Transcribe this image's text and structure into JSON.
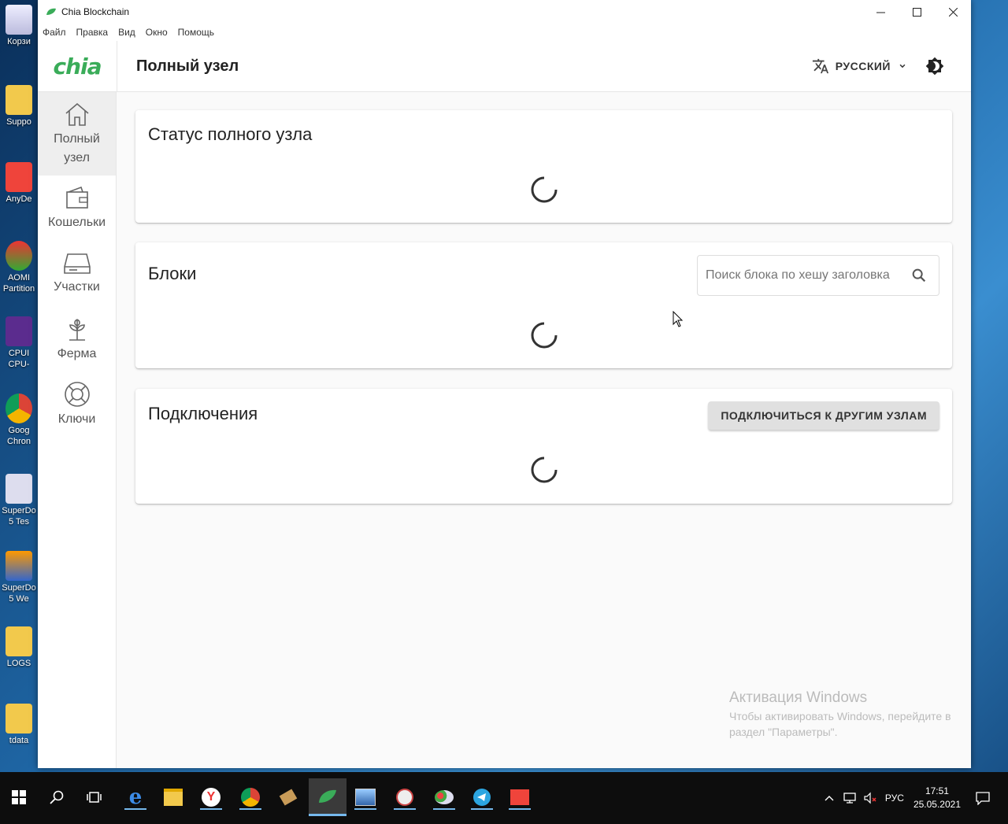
{
  "desktop": {
    "icons": [
      {
        "label": "Корзи",
        "icon": "recycle-bin-icon"
      },
      {
        "label": "Suppo",
        "icon": "folder-icon"
      },
      {
        "label": "AnyDe",
        "icon": "anydesk-icon"
      },
      {
        "label": "AOMI Partition",
        "icon": "partition-icon"
      },
      {
        "label": "CPUI CPU-",
        "icon": "cpuid-icon"
      },
      {
        "label": "Goog Chron",
        "icon": "chrome-icon"
      },
      {
        "label": "SuperDo 5 Tes",
        "icon": "superdoctor-icon"
      },
      {
        "label": "SuperDo 5 We",
        "icon": "superdoctor-web-icon"
      },
      {
        "label": "LOGS",
        "icon": "folder-icon"
      },
      {
        "label": "tdata",
        "icon": "folder-icon"
      }
    ]
  },
  "window": {
    "title": "Chia Blockchain",
    "menu": [
      "Файл",
      "Правка",
      "Вид",
      "Окно",
      "Помощь"
    ]
  },
  "appbar": {
    "logo": "chia",
    "page_title": "Полный узел",
    "language": "РУССКИЙ"
  },
  "sidebar": {
    "items": [
      {
        "label": "Полный узел",
        "icon": "home-icon",
        "active": true
      },
      {
        "label": "Кошельки",
        "icon": "wallet-icon",
        "active": false
      },
      {
        "label": "Участки",
        "icon": "drive-icon",
        "active": false
      },
      {
        "label": "Ферма",
        "icon": "plant-icon",
        "active": false
      },
      {
        "label": "Ключи",
        "icon": "lifebuoy-icon",
        "active": false
      }
    ]
  },
  "cards": {
    "status": {
      "title": "Статус полного узла"
    },
    "blocks": {
      "title": "Блоки",
      "search_placeholder": "Поиск блока по хешу заголовка"
    },
    "connections": {
      "title": "Подключения",
      "connect_button": "ПОДКЛЮЧИТЬСЯ К ДРУГИМ УЗЛАМ"
    }
  },
  "watermark": {
    "line1": "Активация Windows",
    "line2": "Чтобы активировать Windows, перейдите в",
    "line3": "раздел \"Параметры\"."
  },
  "taskbar": {
    "apps": [
      "start-icon",
      "search-icon",
      "task-view-icon",
      "edge-icon",
      "explorer-icon",
      "yandex-icon",
      "chrome-icon",
      "app-icon",
      "chia-icon",
      "network-app-icon",
      "clock-app-icon",
      "paint-icon",
      "telegram-icon",
      "anydesk-icon"
    ],
    "lang": "РУС",
    "time": "17:51",
    "date": "25.05.2021"
  }
}
